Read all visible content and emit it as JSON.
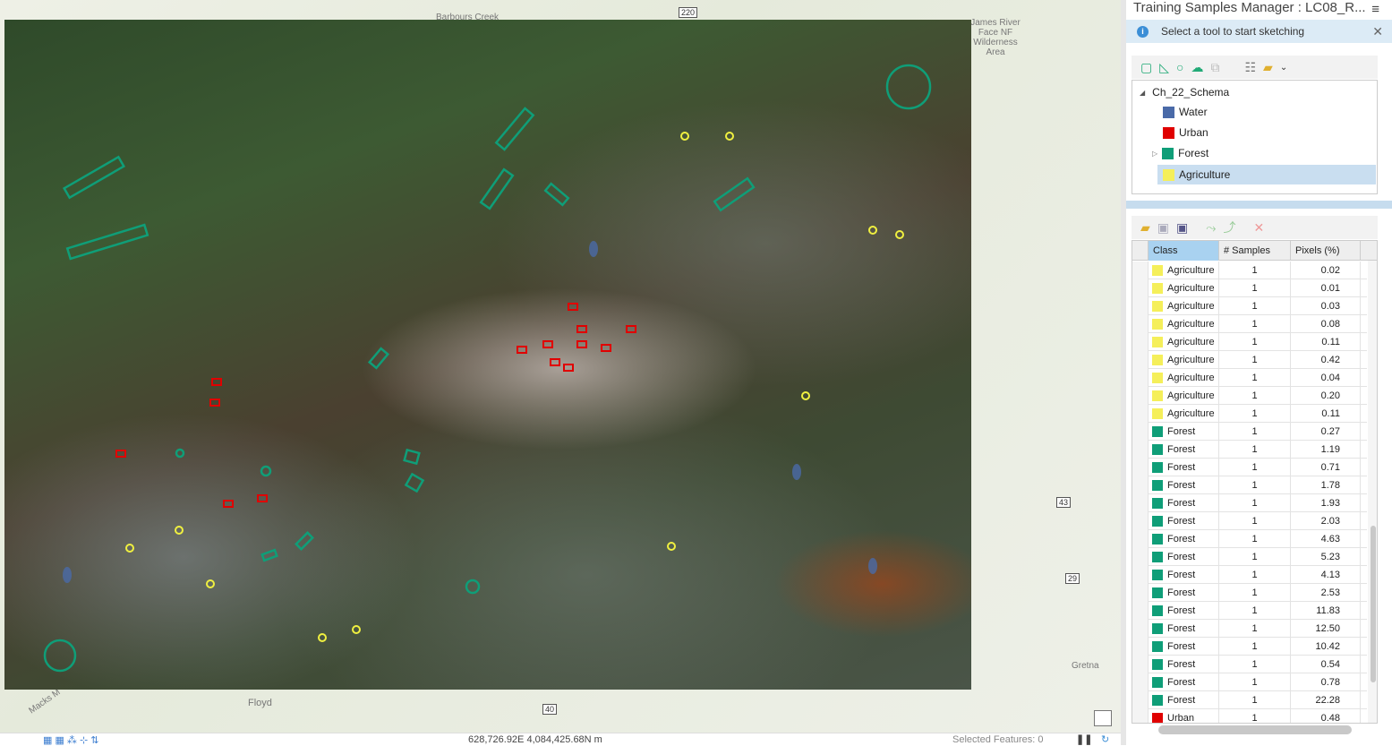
{
  "map": {
    "labels": [
      "Barbours Creek",
      "James River Face NF Wilderness Area",
      "Floyd",
      "Gretna",
      "Macks M"
    ],
    "shields": [
      "220",
      "43",
      "29",
      "40"
    ],
    "sample_colors": {
      "Water": "#4a6aa8",
      "Urban": "#e00000",
      "Forest": "#0f9e78",
      "Agriculture": "#f0f040"
    }
  },
  "panel": {
    "title": "Training Samples Manager : LC08_R...",
    "info_message": "Select a tool to start sketching",
    "toolbar_icons": [
      "rectangle-icon",
      "polygon-icon",
      "circle-icon",
      "freehand-icon",
      "select-segment-icon",
      "create-class-icon",
      "open-folder-icon"
    ],
    "schema": {
      "name": "Ch_22_Schema",
      "classes": [
        {
          "label": "Water",
          "color": "#4a6aa8"
        },
        {
          "label": "Urban",
          "color": "#e00000"
        },
        {
          "label": "Forest",
          "color": "#0f9e78"
        },
        {
          "label": "Agriculture",
          "color": "#f5ef5a",
          "selected": true
        }
      ]
    },
    "table": {
      "headers": [
        "Class",
        "# Samples",
        "Pixels (%)"
      ],
      "rows": [
        {
          "class": "Agriculture",
          "samples": "1",
          "pixels": "0.02",
          "color": "#f5ef5a"
        },
        {
          "class": "Agriculture",
          "samples": "1",
          "pixels": "0.01",
          "color": "#f5ef5a"
        },
        {
          "class": "Agriculture",
          "samples": "1",
          "pixels": "0.03",
          "color": "#f5ef5a"
        },
        {
          "class": "Agriculture",
          "samples": "1",
          "pixels": "0.08",
          "color": "#f5ef5a"
        },
        {
          "class": "Agriculture",
          "samples": "1",
          "pixels": "0.11",
          "color": "#f5ef5a"
        },
        {
          "class": "Agriculture",
          "samples": "1",
          "pixels": "0.42",
          "color": "#f5ef5a"
        },
        {
          "class": "Agriculture",
          "samples": "1",
          "pixels": "0.04",
          "color": "#f5ef5a"
        },
        {
          "class": "Agriculture",
          "samples": "1",
          "pixels": "0.20",
          "color": "#f5ef5a"
        },
        {
          "class": "Agriculture",
          "samples": "1",
          "pixels": "0.11",
          "color": "#f5ef5a"
        },
        {
          "class": "Forest",
          "samples": "1",
          "pixels": "0.27",
          "color": "#0f9e78"
        },
        {
          "class": "Forest",
          "samples": "1",
          "pixels": "1.19",
          "color": "#0f9e78"
        },
        {
          "class": "Forest",
          "samples": "1",
          "pixels": "0.71",
          "color": "#0f9e78"
        },
        {
          "class": "Forest",
          "samples": "1",
          "pixels": "1.78",
          "color": "#0f9e78"
        },
        {
          "class": "Forest",
          "samples": "1",
          "pixels": "1.93",
          "color": "#0f9e78"
        },
        {
          "class": "Forest",
          "samples": "1",
          "pixels": "2.03",
          "color": "#0f9e78"
        },
        {
          "class": "Forest",
          "samples": "1",
          "pixels": "4.63",
          "color": "#0f9e78"
        },
        {
          "class": "Forest",
          "samples": "1",
          "pixels": "5.23",
          "color": "#0f9e78"
        },
        {
          "class": "Forest",
          "samples": "1",
          "pixels": "4.13",
          "color": "#0f9e78"
        },
        {
          "class": "Forest",
          "samples": "1",
          "pixels": "2.53",
          "color": "#0f9e78"
        },
        {
          "class": "Forest",
          "samples": "1",
          "pixels": "11.83",
          "color": "#0f9e78"
        },
        {
          "class": "Forest",
          "samples": "1",
          "pixels": "12.50",
          "color": "#0f9e78"
        },
        {
          "class": "Forest",
          "samples": "1",
          "pixels": "10.42",
          "color": "#0f9e78"
        },
        {
          "class": "Forest",
          "samples": "1",
          "pixels": "0.54",
          "color": "#0f9e78"
        },
        {
          "class": "Forest",
          "samples": "1",
          "pixels": "0.78",
          "color": "#0f9e78"
        },
        {
          "class": "Forest",
          "samples": "1",
          "pixels": "22.28",
          "color": "#0f9e78"
        },
        {
          "class": "Urban",
          "samples": "1",
          "pixels": "0.48",
          "color": "#e00000"
        }
      ]
    }
  },
  "status": {
    "coordinates": "628,726.92E 4,084,425.68N m",
    "selected_features": "Selected Features: 0"
  }
}
